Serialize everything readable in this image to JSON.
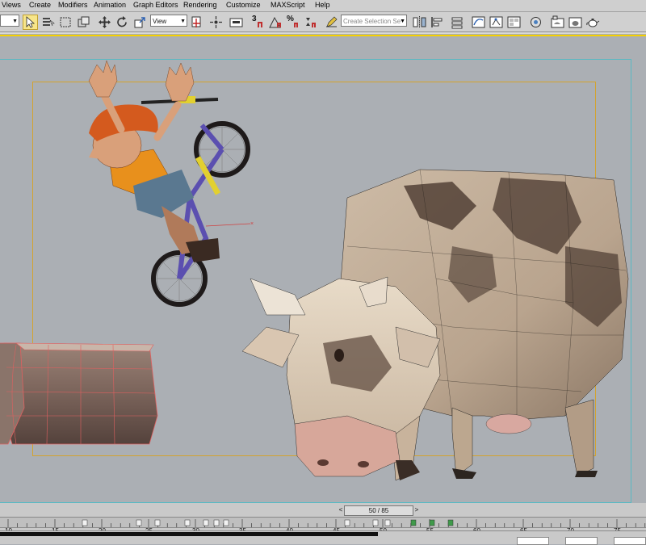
{
  "menu": {
    "items": [
      "Views",
      "Create",
      "Modifiers",
      "Animation",
      "Graph Editors",
      "Rendering",
      "Customize",
      "MAXScript",
      "Help"
    ]
  },
  "toolbar": {
    "view_label": "View",
    "number_badge": "3",
    "percent_badge": "%",
    "selection_set_placeholder": "Create Selection Se"
  },
  "timeline": {
    "frame_display": "50 / 85",
    "current_frame": 50,
    "total_frames": 85,
    "ticks": [
      "10",
      "15",
      "20",
      "25",
      "30",
      "35",
      "40",
      "45",
      "50",
      "55",
      "60",
      "65",
      "70",
      "75"
    ]
  },
  "colors": {
    "viewport_bg": "#abafb4",
    "active_border": "#f5d000",
    "safe_frame": "#58b9c3",
    "render_frame": "#d3a32e"
  }
}
